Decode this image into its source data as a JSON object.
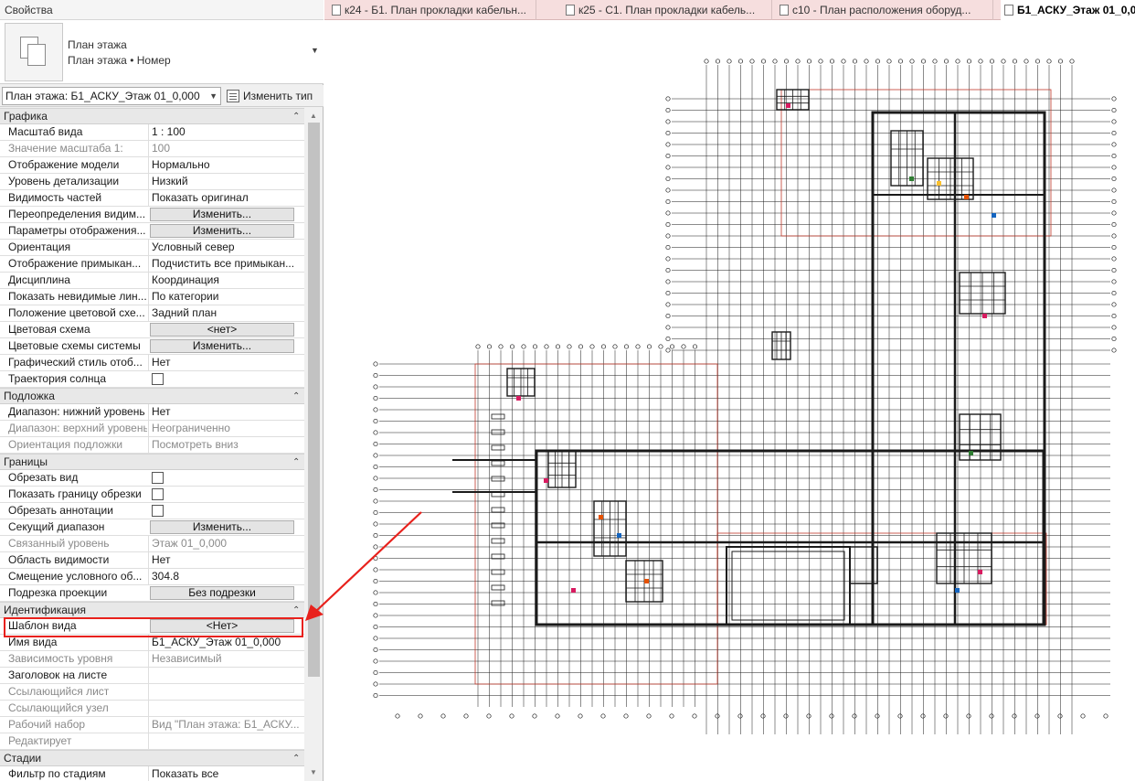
{
  "panel": {
    "title": "Свойства",
    "type_selector": {
      "line1": "План этажа",
      "line2": "План этажа • Номер"
    },
    "instance_selector": "План этажа: Б1_АСКУ_Этаж 01_0,000",
    "edit_type_label": "Изменить тип"
  },
  "groups": {
    "grafika": "Графика",
    "podlozhka": "Подложка",
    "granitsy": "Границы",
    "identifikatsiya": "Идентификация",
    "stadii": "Стадии"
  },
  "rows": {
    "scale": {
      "label": "Масштаб вида",
      "value": "1 : 100"
    },
    "scale_value": {
      "label": "Значение масштаба    1:",
      "value": "100"
    },
    "model_display": {
      "label": "Отображение модели",
      "value": "Нормально"
    },
    "detail_level": {
      "label": "Уровень детализации",
      "value": "Низкий"
    },
    "parts_visibility": {
      "label": "Видимость частей",
      "value": "Показать оригинал"
    },
    "visibility_overrides": {
      "label": "Переопределения видим...",
      "value": "Изменить..."
    },
    "display_options": {
      "label": "Параметры отображения...",
      "value": "Изменить..."
    },
    "orientation": {
      "label": "Ориентация",
      "value": "Условный север"
    },
    "wall_join": {
      "label": "Отображение примыкан...",
      "value": "Подчистить все примыкан..."
    },
    "discipline": {
      "label": "Дисциплина",
      "value": "Координация"
    },
    "hidden_lines": {
      "label": "Показать невидимые лин...",
      "value": "По категории"
    },
    "color_scheme_location": {
      "label": "Положение цветовой схе...",
      "value": "Задний план"
    },
    "color_scheme": {
      "label": "Цветовая схема",
      "value": "<нет>"
    },
    "system_color_schemes": {
      "label": "Цветовые схемы системы",
      "value": "Изменить..."
    },
    "graphic_style": {
      "label": "Графический стиль отоб...",
      "value": "Нет"
    },
    "sun_path": {
      "label": "Траектория солнца",
      "value": ""
    },
    "underlay_bottom": {
      "label": "Диапазон: нижний уровень",
      "value": "Нет"
    },
    "underlay_top": {
      "label": "Диапазон: верхний уровень",
      "value": "Неограниченно"
    },
    "underlay_orientation": {
      "label": "Ориентация подложки",
      "value": "Посмотреть вниз"
    },
    "crop_view": {
      "label": "Обрезать вид",
      "value": ""
    },
    "crop_region_visible": {
      "label": "Показать границу обрезки",
      "value": ""
    },
    "annotation_crop": {
      "label": "Обрезать аннотации",
      "value": ""
    },
    "view_range": {
      "label": "Секущий диапазон",
      "value": "Изменить..."
    },
    "associated_level": {
      "label": "Связанный уровень",
      "value": "Этаж 01_0,000"
    },
    "scope_box": {
      "label": "Область видимости",
      "value": "Нет"
    },
    "north_offset": {
      "label": "Смещение условного об...",
      "value": "304.8"
    },
    "depth_clipping": {
      "label": "Подрезка проекции",
      "value": "Без подрезки"
    },
    "view_template": {
      "label": "Шаблон вида",
      "value": "<Нет>"
    },
    "view_name": {
      "label": "Имя вида",
      "value": "Б1_АСКУ_Этаж 01_0,000"
    },
    "dependency": {
      "label": "Зависимость уровня",
      "value": "Независимый"
    },
    "title_on_sheet": {
      "label": "Заголовок на листе",
      "value": ""
    },
    "referencing_sheet": {
      "label": "Ссылающийся лист",
      "value": ""
    },
    "referencing_detail": {
      "label": "Ссылающийся узел",
      "value": ""
    },
    "workset": {
      "label": "Рабочий набор",
      "value": "Вид \"План этажа: Б1_АСКУ..."
    },
    "edited_by": {
      "label": "Редактирует",
      "value": ""
    },
    "phase_filter": {
      "label": "Фильтр по стадиям",
      "value": "Показать все"
    }
  },
  "tabs": [
    {
      "label": "к24 - Б1. План прокладки кабельн..."
    },
    {
      "label": "к25 - С1. План прокладки кабель..."
    },
    {
      "label": "с10 - План расположения оборуд..."
    },
    {
      "label": "Б1_АСКУ_Этаж 01_0,000"
    }
  ],
  "colors": {
    "highlight": "#e8211c",
    "tabbar_bg": "#f6dede",
    "plan_line": "#1a1a1a",
    "plan_accent_red": "#c0392b"
  },
  "icons": {
    "type_thumbnail": "floor-plan-icon",
    "edit_type": "edit-type-icon",
    "collapse": "collapse-chevron-icon"
  }
}
